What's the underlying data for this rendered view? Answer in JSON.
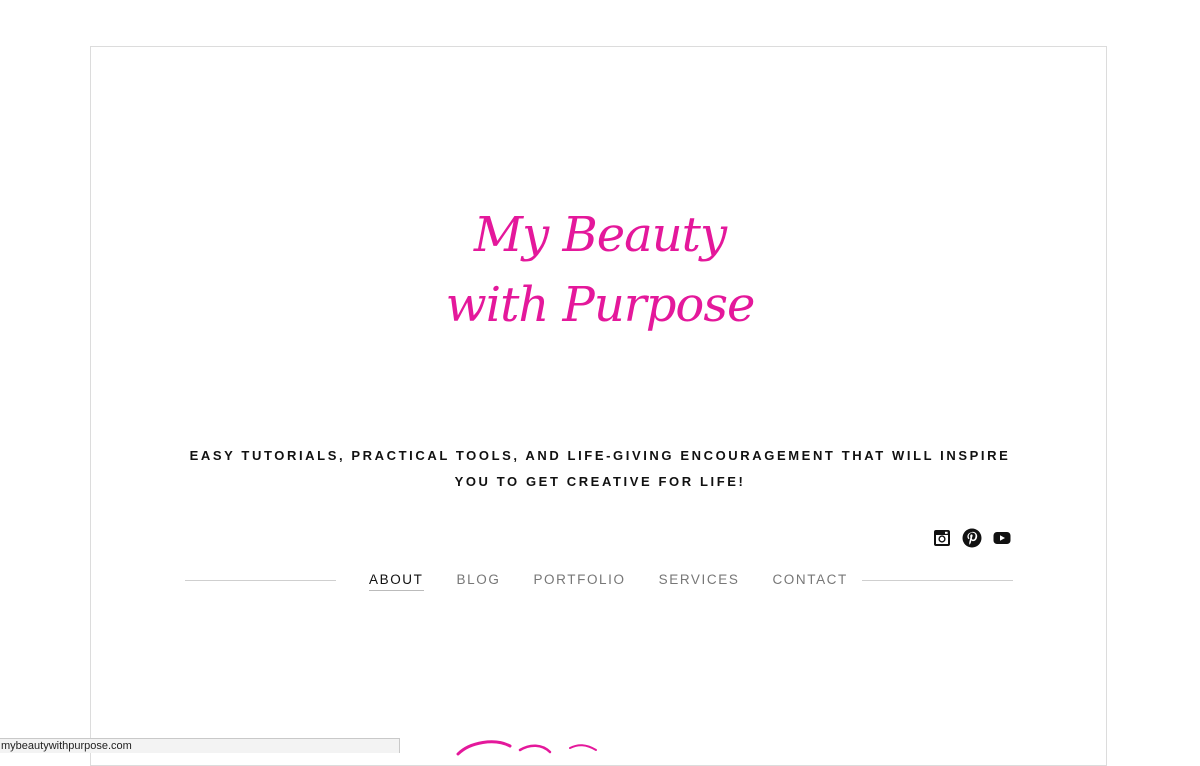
{
  "logo": {
    "line1": "My Beauty",
    "line2": "with Purpose",
    "color": "#e4189b"
  },
  "tagline": {
    "line1": "EASY TUTORIALS, PRACTICAL TOOLS, AND LIFE-GIVING ENCOURAGEMENT THAT WILL INSPIRE",
    "line2": "YOU TO GET CREATIVE FOR LIFE!"
  },
  "social": [
    {
      "icon": "instagram-icon"
    },
    {
      "icon": "pinterest-icon"
    },
    {
      "icon": "youtube-icon"
    }
  ],
  "nav": {
    "items": [
      {
        "label": "ABOUT",
        "active": true
      },
      {
        "label": "BLOG",
        "active": false
      },
      {
        "label": "PORTFOLIO",
        "active": false
      },
      {
        "label": "SERVICES",
        "active": false
      },
      {
        "label": "CONTACT",
        "active": false
      }
    ]
  },
  "status_bar": {
    "url": "mybeautywithpurpose.com"
  }
}
